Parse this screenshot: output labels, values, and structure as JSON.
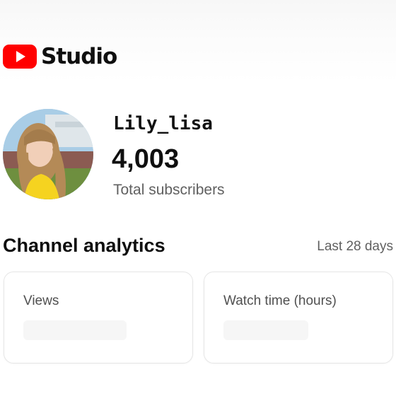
{
  "app": {
    "logo_text": "Studio",
    "logo_icon": "youtube-play-icon",
    "brand_color": "#ff0000"
  },
  "channel": {
    "name": "Lily_lisa",
    "subscriber_count": "4,003",
    "subscriber_label": "Total subscribers"
  },
  "analytics": {
    "title": "Channel analytics",
    "period": "Last 28 days",
    "cards": [
      {
        "label": "Views"
      },
      {
        "label": "Watch time (hours)"
      }
    ]
  }
}
